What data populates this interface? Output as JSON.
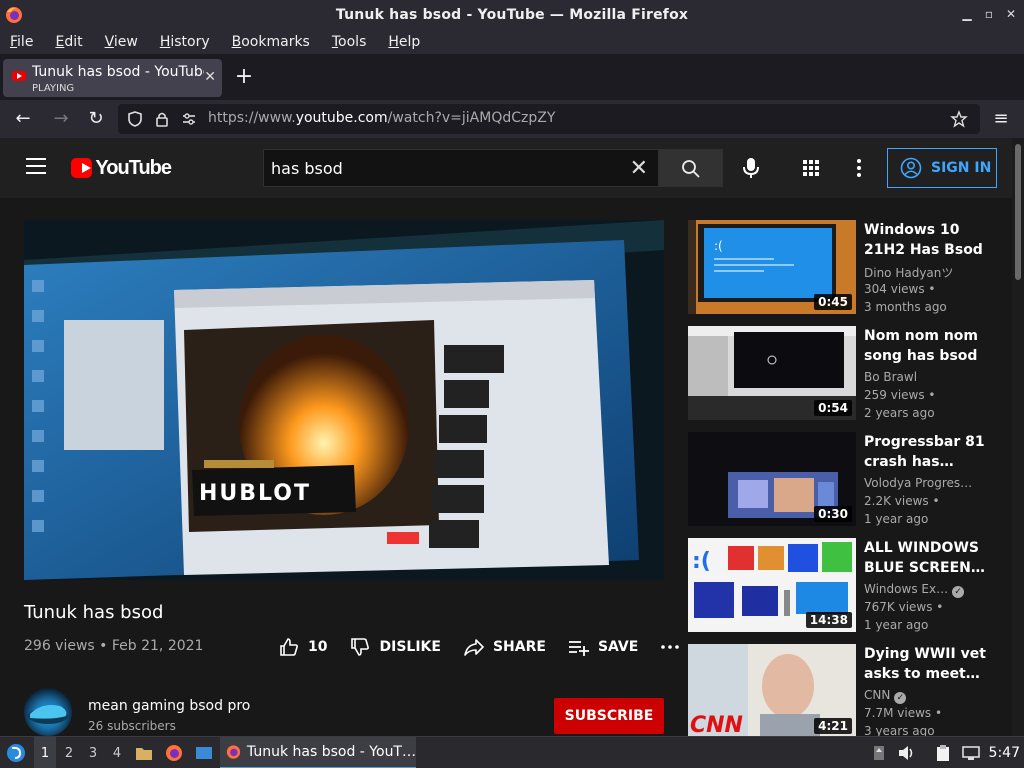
{
  "window": {
    "title": "Tunuk has bsod - YouTube — Mozilla Firefox"
  },
  "menu": {
    "items": [
      {
        "label": "File",
        "accel": "F",
        "rest": "ile"
      },
      {
        "label": "Edit",
        "accel": "E",
        "rest": "dit"
      },
      {
        "label": "View",
        "accel": "V",
        "rest": "iew"
      },
      {
        "label": "History",
        "accel": "H",
        "rest": "istory"
      },
      {
        "label": "Bookmarks",
        "accel": "B",
        "rest": "ookmarks"
      },
      {
        "label": "Tools",
        "accel": "T",
        "rest": "ools"
      },
      {
        "label": "Help",
        "accel": "H",
        "rest": "elp"
      }
    ]
  },
  "tab": {
    "title": "Tunuk has bsod - YouTube",
    "status": "PLAYING"
  },
  "url": {
    "prefix": "https://www.",
    "domain": "youtube.com",
    "path": "/watch?v=jiAMQdCzpZY"
  },
  "youtube": {
    "search_value": "has bsod",
    "sign_in": "SIGN IN",
    "logo_text": "YouTube"
  },
  "video": {
    "title": "Tunuk has bsod",
    "meta": "296 views • Feb 21, 2021",
    "likes": "10",
    "dislike_label": "DISLIKE",
    "share_label": "SHARE",
    "save_label": "SAVE",
    "channel_name": "mean gaming bsod pro",
    "channel_subs": "26 subscribers",
    "subscribe_label": "SUBSCRIBE"
  },
  "related": [
    {
      "title": "Windows 10 21H2 Has Bsod",
      "channel": "Dino Hadyanツ",
      "verified": false,
      "views": "304 views •",
      "ago": "3 months ago",
      "duration": "0:45"
    },
    {
      "title": "Nom nom nom song has bsod",
      "channel": "Bo Brawl",
      "verified": false,
      "views": "259 views •",
      "ago": "2 years ago",
      "duration": "0:54"
    },
    {
      "title": "Progressbar 81 crash has…",
      "channel": "Volodya Progres…",
      "verified": false,
      "views": "2.2K views •",
      "ago": "1 year ago",
      "duration": "0:30"
    },
    {
      "title": "ALL WINDOWS BLUE SCREEN…",
      "channel": "Windows Ex…",
      "verified": true,
      "views": "767K views •",
      "ago": "1 year ago",
      "duration": "14:38"
    },
    {
      "title": "Dying WWII vet asks to meet…",
      "channel": "CNN",
      "verified": true,
      "views": "7.7M views •",
      "ago": "3 years ago",
      "duration": "4:21"
    }
  ],
  "taskbar": {
    "workspaces": [
      "1",
      "2",
      "3",
      "4"
    ],
    "active_task": "Tunuk has bsod - YouT…",
    "clock": "5:47"
  },
  "colors": {
    "yt_red": "#ff0000",
    "link_blue": "#3ea6ff",
    "subscribe_red": "#cc0000"
  }
}
